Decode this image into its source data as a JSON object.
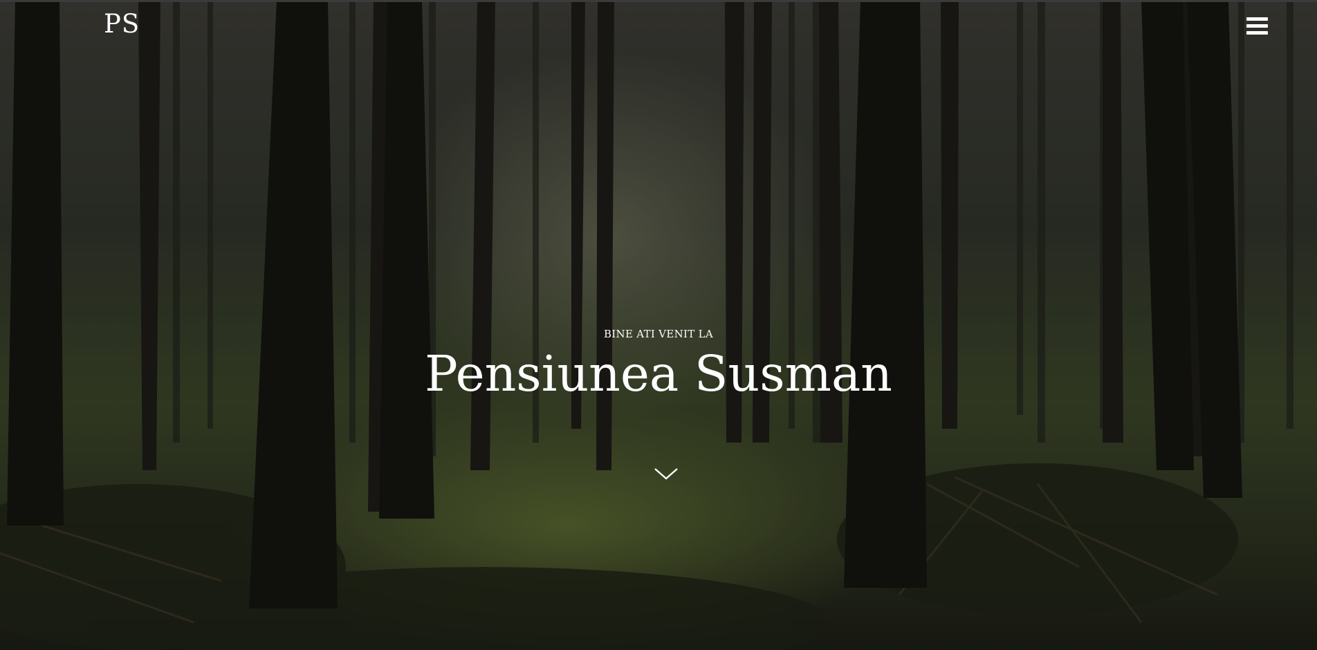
{
  "header": {
    "logo_text": "PS",
    "menu_icon": "hamburger-menu-icon"
  },
  "hero": {
    "background": "forest-photo",
    "subtitle": "BINE ATI VENIT LA",
    "title": "Pensiunea Susman",
    "scroll_icon": "chevron-down-icon"
  },
  "colors": {
    "text": "#ffffff",
    "top_bar": "#3b3b3b"
  }
}
